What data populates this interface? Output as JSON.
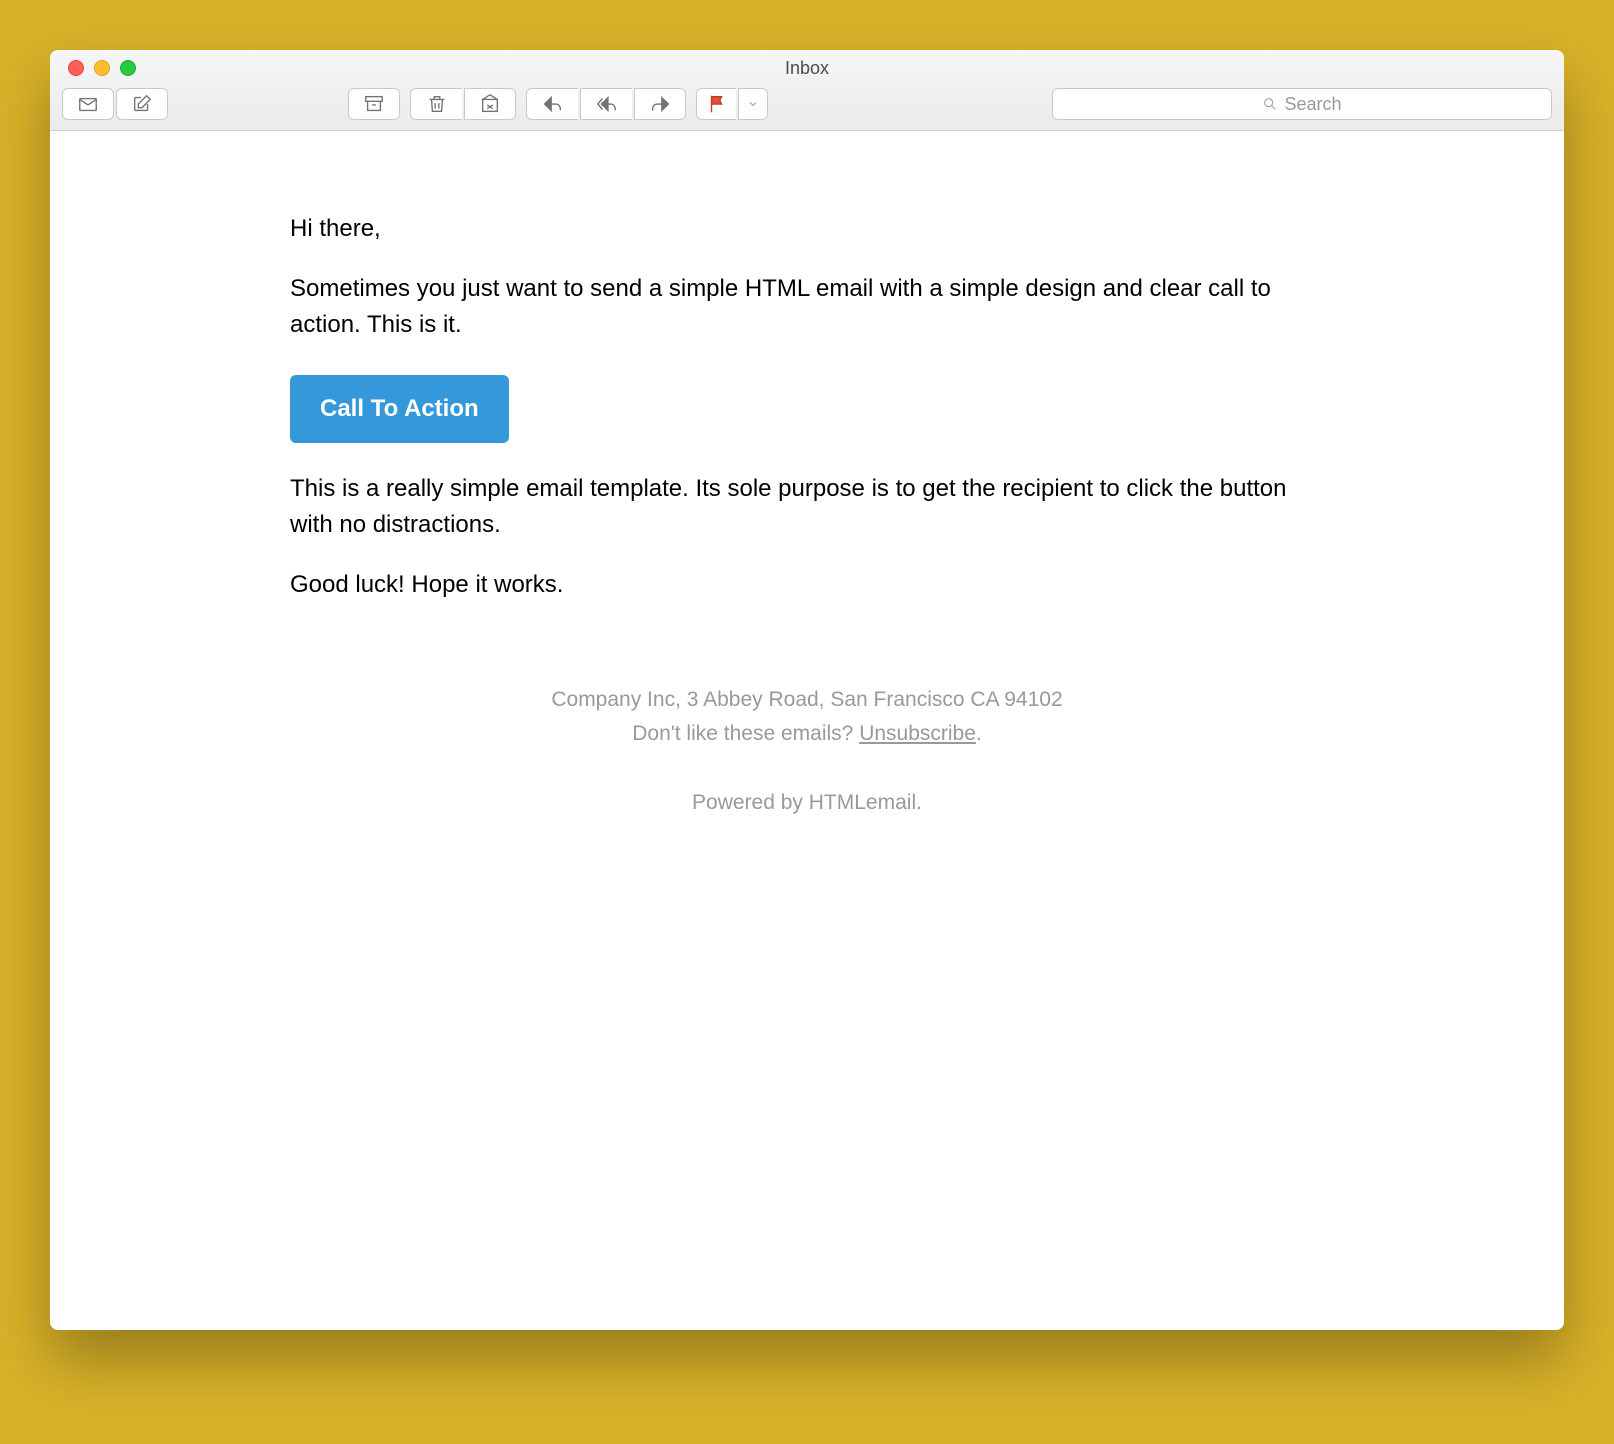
{
  "window": {
    "title": "Inbox"
  },
  "toolbar": {
    "search_placeholder": "Search"
  },
  "email": {
    "greeting": "Hi there,",
    "intro": "Sometimes you just want to send a simple HTML email with a simple design and clear call to action. This is it.",
    "cta_label": "Call To Action",
    "body2": "This is a really simple email template. Its sole purpose is to get the recipient to click the button with no distractions.",
    "closing": "Good luck! Hope it works."
  },
  "footer": {
    "company": "Company Inc, 3 Abbey Road, San Francisco CA 94102",
    "unsubscribe_prompt": "Don't like these emails? ",
    "unsubscribe_link": "Unsubscribe",
    "period": ".",
    "powered": "Powered by HTMLemail."
  }
}
